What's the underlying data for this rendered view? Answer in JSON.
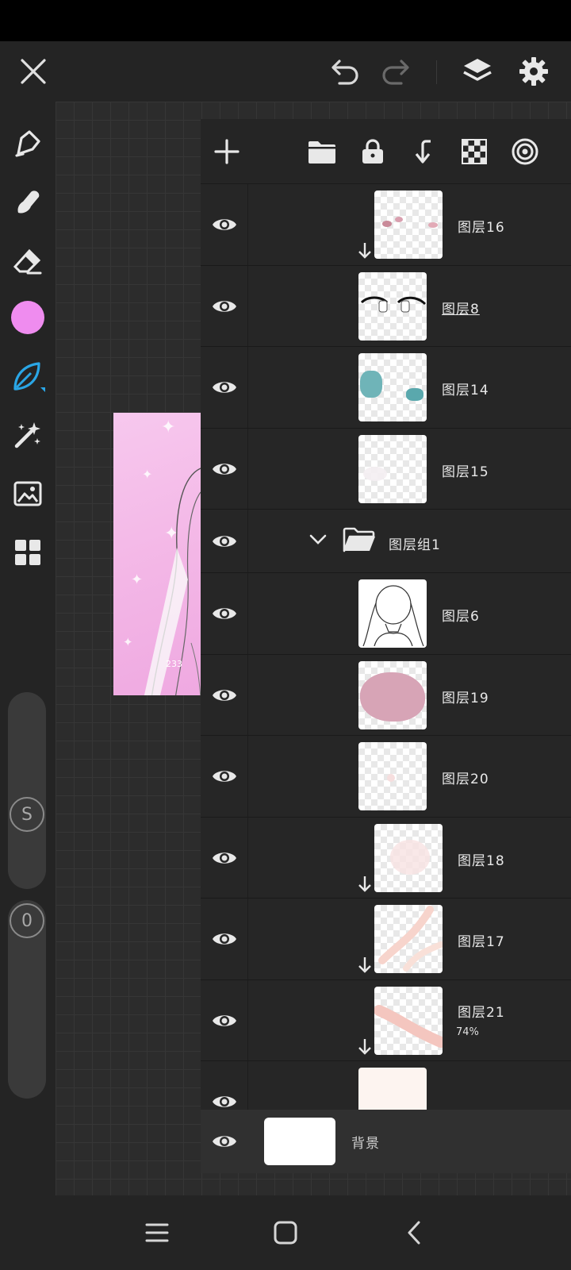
{
  "colors": {
    "accent_blue": "#2aa6e6",
    "current_color": "#ef8cef",
    "panel_bg": "#252525",
    "canvas_bg": "#2c2c2c"
  },
  "top_bar": {
    "close_icon": "close-icon",
    "undo_icon": "undo-icon",
    "redo_icon": "redo-icon",
    "layers_icon": "layers-icon",
    "settings_icon": "gear-icon"
  },
  "toolbar": {
    "tools": [
      "pen-tool-icon",
      "smudge-tool-icon",
      "eraser-tool-icon",
      "color-swatch",
      "brush-leaf-icon",
      "magic-wand-icon",
      "image-icon",
      "grid-icon"
    ],
    "size_slider_label": "S",
    "opacity_slider_label": "0"
  },
  "layers_toolbar": {
    "icons": [
      "add-layer-icon",
      "folder-icon",
      "lock-icon",
      "merge-down-icon",
      "checkerboard-icon",
      "target-icon"
    ]
  },
  "layers": [
    {
      "name": "图层16",
      "clipped": true,
      "opacity": ""
    },
    {
      "name": "图层8",
      "clipped": false,
      "opacity": ""
    },
    {
      "name": "图层14",
      "clipped": false,
      "opacity": ""
    },
    {
      "name": "图层15",
      "clipped": false,
      "opacity": ""
    },
    {
      "name": "图层组1",
      "is_group": true
    },
    {
      "name": "图层6",
      "clipped": false,
      "opacity": ""
    },
    {
      "name": "图层19",
      "clipped": false,
      "opacity": ""
    },
    {
      "name": "图层20",
      "clipped": false,
      "opacity": ""
    },
    {
      "name": "图层18",
      "clipped": true,
      "opacity": ""
    },
    {
      "name": "图层17",
      "clipped": true,
      "opacity": ""
    },
    {
      "name": "图层21",
      "clipped": true,
      "opacity": "74%"
    }
  ],
  "background_layer": {
    "name": "背景"
  },
  "artwork_watermark": "233",
  "nav": {
    "recents_icon": "recents-icon",
    "home_icon": "home-icon",
    "back_icon": "back-icon"
  }
}
